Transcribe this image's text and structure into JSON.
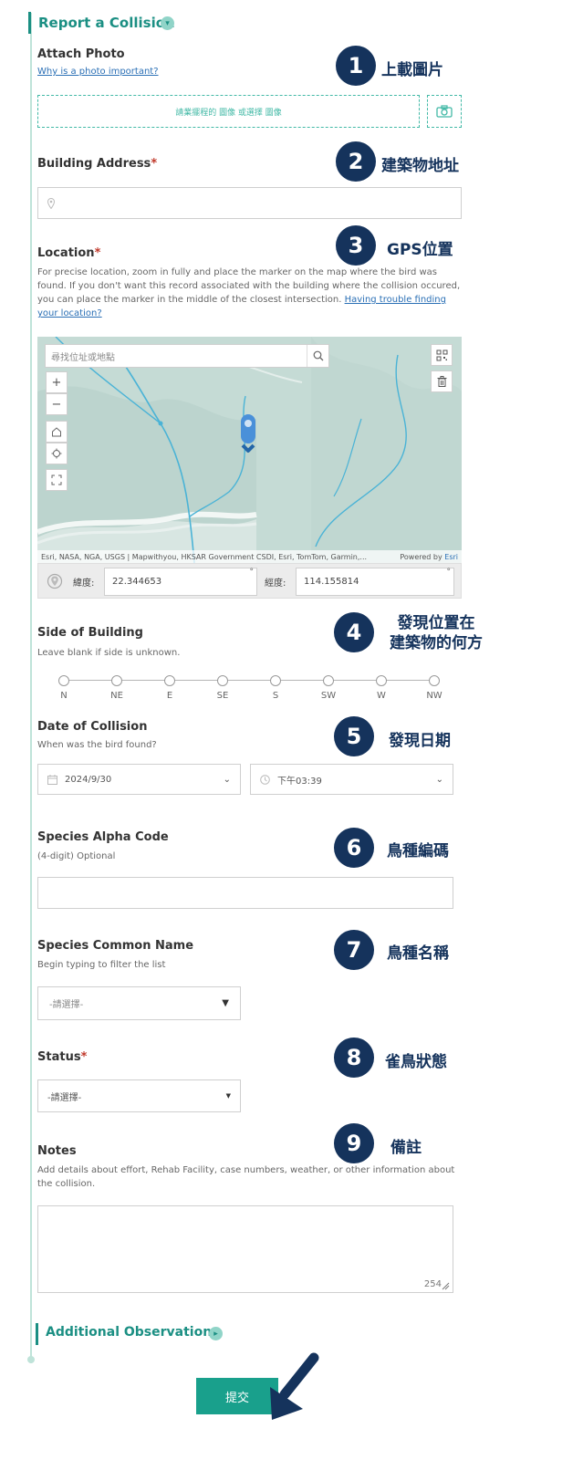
{
  "section": {
    "title": "Report a Collision"
  },
  "photo": {
    "label": "Attach Photo",
    "why_link": "Why is a photo important?",
    "dropzone_text": "請業擺程的 圖像 或選擇 圖像"
  },
  "address": {
    "label": "Building Address",
    "required": "*"
  },
  "location": {
    "label": "Location",
    "required": "*",
    "hint": "For precise location, zoom in fully and place the marker on the map where the bird was found. If you don't want this record associated with the building where the collision occured, you can place the marker in the middle of the closest intersection.",
    "help_link": "Having trouble finding your location?",
    "map_search_placeholder": "尋找位址或地點",
    "attribution": "Esri, NASA, NGA, USGS | Mapwithyou, HKSAR Government CSDI, Esri, TomTom, Garmin,...",
    "powered_by": "Powered by",
    "powered_brand": "Esri",
    "lat_label": "緯度:",
    "lat_value": "22.344653",
    "lon_label": "經度:",
    "lon_value": "114.155814",
    "deg": "°"
  },
  "side": {
    "label": "Side of Building",
    "hint": "Leave blank if side is unknown.",
    "options": [
      "N",
      "NE",
      "E",
      "SE",
      "S",
      "SW",
      "W",
      "NW"
    ]
  },
  "date": {
    "label": "Date of Collision",
    "hint": "When was the bird found?",
    "date_value": "2024/9/30",
    "time_value": "下午03:39"
  },
  "alpha": {
    "label": "Species Alpha Code",
    "hint": "(4-digit) Optional"
  },
  "common": {
    "label": "Species Common Name",
    "hint": "Begin typing to filter the list",
    "placeholder": "-請選擇-"
  },
  "status": {
    "label": "Status",
    "required": "*",
    "placeholder": "-請選擇-"
  },
  "notes": {
    "label": "Notes",
    "hint": "Add details about effort, Rehab Facility, case numbers, weather, or other information about the collision.",
    "counter": "254"
  },
  "additional": {
    "title": "Additional Observations"
  },
  "submit_label": "提交",
  "annotations": [
    {
      "num": "1",
      "text": "上載圖片"
    },
    {
      "num": "2",
      "text": "建築物地址"
    },
    {
      "num": "3",
      "text": "GPS位置"
    },
    {
      "num": "4",
      "line1": "發現位置在",
      "line2": "建築物的何方"
    },
    {
      "num": "5",
      "text": "發現日期"
    },
    {
      "num": "6",
      "text": "鳥種編碼"
    },
    {
      "num": "7",
      "text": "鳥種名稱"
    },
    {
      "num": "8",
      "text": "雀鳥狀態"
    },
    {
      "num": "9",
      "text": "備註"
    }
  ],
  "colors": {
    "accent": "#1b8f83",
    "badge": "#15335c",
    "submit": "#19a08c",
    "map_water": "#4ab3d6"
  }
}
